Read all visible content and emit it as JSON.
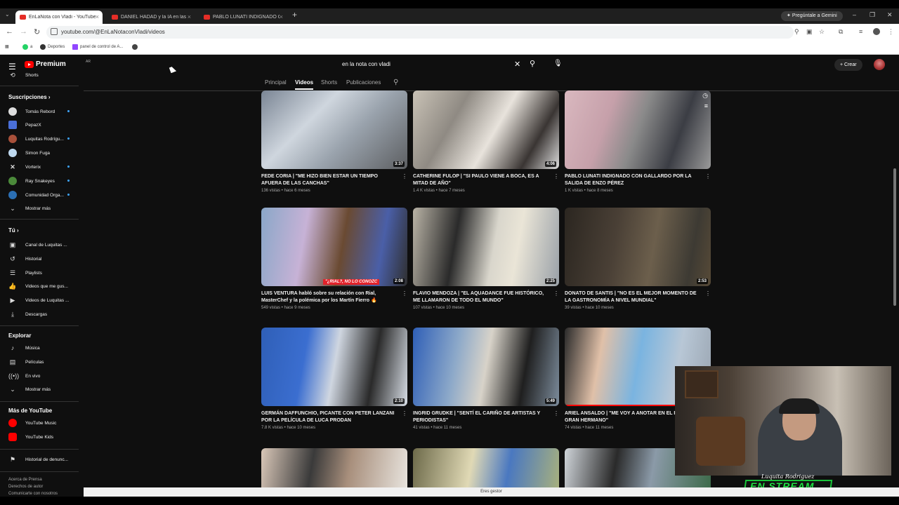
{
  "browser": {
    "tabs": [
      {
        "title": "EnLaNota con Vladi - YouTube",
        "active": true
      },
      {
        "title": "DANIEL HADAD y la IA en las EMP...",
        "active": false
      },
      {
        "title": "PABLO LUNATI INDIGNADO CON ...",
        "active": false
      }
    ],
    "new_tab": "+",
    "gemini_button": "Pregúntale a Gemini",
    "url": "youtube.com/@EnLaNotaconVladi/videos",
    "bookmarks": [
      "a",
      "Deportes",
      "panel de control de A..."
    ],
    "status_text": "Eres gestor"
  },
  "youtube": {
    "logo_label": "Premium",
    "logo_sup": "AR",
    "search_query": "en la nota con vladi",
    "create_label": "Crear",
    "channel_tabs": [
      "Principal",
      "Videos",
      "Shorts",
      "Publicaciones"
    ],
    "active_tab": "Videos"
  },
  "sidebar": {
    "top_item": "Shorts",
    "subscriptions_header": "Suscripciones",
    "subscriptions": [
      {
        "name": "Tomás Rebord",
        "new": true
      },
      {
        "name": "PepazX",
        "new": false
      },
      {
        "name": "Luquitas Rodrígu...",
        "new": true
      },
      {
        "name": "Simon Fuga",
        "new": false
      },
      {
        "name": "Vorterix",
        "new": true
      },
      {
        "name": "Ray Snakeyes",
        "new": true
      },
      {
        "name": "Comunidad Orga...",
        "new": true
      }
    ],
    "show_more": "Mostrar más",
    "you_header": "Tú",
    "you_items": [
      "Canal de Luquitas ...",
      "Historial",
      "Playlists",
      "Videos que me gus...",
      "Videos de Luquitas ...",
      "Descargas"
    ],
    "explore_header": "Explorar",
    "explore_items": [
      "Música",
      "Películas",
      "En vivo",
      "Mostrar más"
    ],
    "more_header": "Más de YouTube",
    "more_items": [
      "YouTube Music",
      "YouTube Kids"
    ],
    "report_history": "Historial de denunc...",
    "footer_links": [
      "Acerca de  Prensa",
      "Derechos de autor",
      "Comunicarte con nosotros"
    ]
  },
  "videos": [
    {
      "title": "FEDE CORIA | \"ME HIZO BIEN ESTAR UN TIEMPO AFUERA DE LAS CANCHAS\"",
      "meta": "136 vistas • hace 6 meses",
      "duration": "3:37"
    },
    {
      "title": "CATHERINE FULOP | \"SI PAULO VIENE A BOCA, ES A MITAD DE AÑO\"",
      "meta": "1.4 K vistas • hace 7 meses",
      "duration": "4:06"
    },
    {
      "title": "PABLO LUNATI INDIGNADO CON GALLARDO POR LA SALIDA DE ENZO PÉREZ",
      "meta": "1 K vistas • hace 8 meses",
      "duration": ""
    },
    {
      "title": "LUIS VENTURA habló sobre su relación con Rial, MasterChef y la polémica por los Martín Fierro 🔥",
      "meta": "549 vistas • hace 9 meses",
      "duration": "2:08",
      "overlay": "\"¿RIAL?, NO LO CONOZC"
    },
    {
      "title": "FLAVIO MENDOZA | \"EL AQUADANCE FUE HISTÓRICO, ME LLAMARON DE TODO EL MUNDO\"",
      "meta": "107 vistas • hace 10 meses",
      "duration": "2:25"
    },
    {
      "title": "DONATO DE SANTIS | \"NO ES EL MEJOR MOMENTO DE LA GASTRONOMÍA A NIVEL MUNDIAL\"",
      "meta": "39 vistas • hace 10 meses",
      "duration": "2:53"
    },
    {
      "title": "GERMÁN DAFFUNCHIO, PICANTE CON PETER LANZANI POR LA PELÍCULA DE LUCA PRODAN",
      "meta": "7.8 K vistas • hace 10 meses",
      "duration": "2:10"
    },
    {
      "title": "INGRID GRUDKE | \"SENTÍ EL CARIÑO DE ARTISTAS Y PERIODISTAS\"",
      "meta": "41 vistas • hace 11 meses",
      "duration": "5:49"
    },
    {
      "title": "ARIEL ANSALDO | \"ME VOY A ANOTAR EN EL PRÓXIMO GRAN HERMANO\"",
      "meta": "74 vistas • hace 11 meses",
      "duration": ""
    }
  ],
  "overlay": {
    "signature": "Luquita Rodriguez",
    "stream_word": "EN STREAM"
  },
  "colors": {
    "background": "#0f0f0f",
    "youtube_red": "#ff0000",
    "stream_green": "#1fe043"
  }
}
